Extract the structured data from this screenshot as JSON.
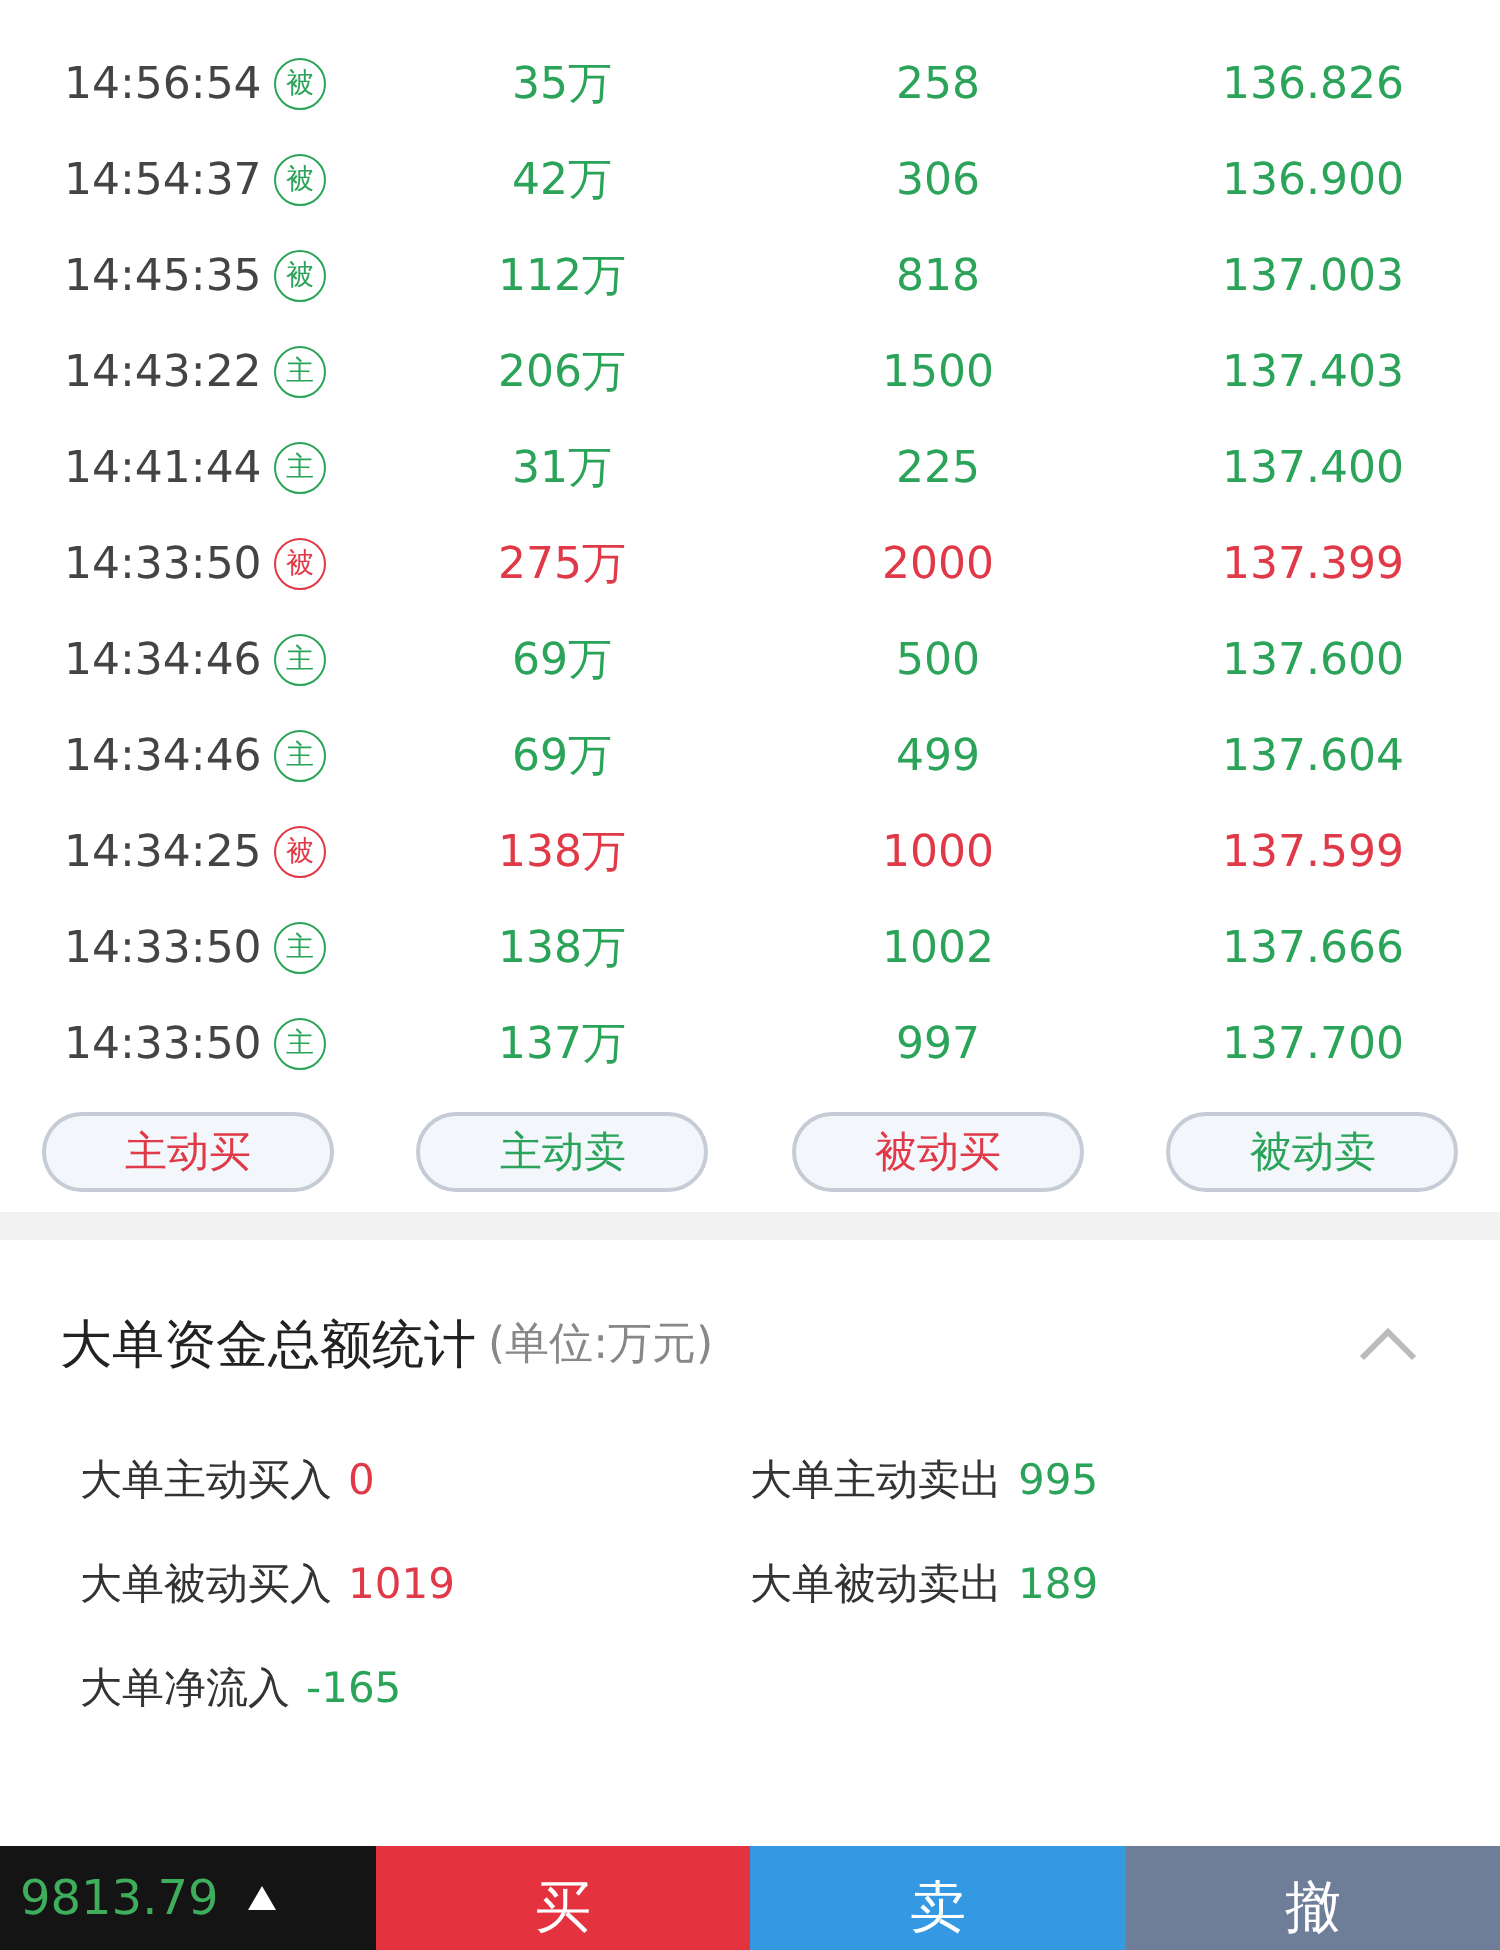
{
  "trades": [
    {
      "time": "14:56:54",
      "tag": "被",
      "amount": "35万",
      "volume": "258",
      "price": "136.826",
      "color": "#2ba45a"
    },
    {
      "time": "14:54:37",
      "tag": "被",
      "amount": "42万",
      "volume": "306",
      "price": "136.900",
      "color": "#2ba45a"
    },
    {
      "time": "14:45:35",
      "tag": "被",
      "amount": "112万",
      "volume": "818",
      "price": "137.003",
      "color": "#2ba45a"
    },
    {
      "time": "14:43:22",
      "tag": "主",
      "amount": "206万",
      "volume": "1500",
      "price": "137.403",
      "color": "#2ba45a"
    },
    {
      "time": "14:41:44",
      "tag": "主",
      "amount": "31万",
      "volume": "225",
      "price": "137.400",
      "color": "#2ba45a"
    },
    {
      "time": "14:33:50",
      "tag": "被",
      "amount": "275万",
      "volume": "2000",
      "price": "137.399",
      "color": "#e03a48"
    },
    {
      "time": "14:34:46",
      "tag": "主",
      "amount": "69万",
      "volume": "500",
      "price": "137.600",
      "color": "#2ba45a"
    },
    {
      "time": "14:34:46",
      "tag": "主",
      "amount": "69万",
      "volume": "499",
      "price": "137.604",
      "color": "#2ba45a"
    },
    {
      "time": "14:34:25",
      "tag": "被",
      "amount": "138万",
      "volume": "1000",
      "price": "137.599",
      "color": "#e03a48"
    },
    {
      "time": "14:33:50",
      "tag": "主",
      "amount": "138万",
      "volume": "1002",
      "price": "137.666",
      "color": "#2ba45a"
    },
    {
      "time": "14:33:50",
      "tag": "主",
      "amount": "137万",
      "volume": "997",
      "price": "137.700",
      "color": "#2ba45a"
    }
  ],
  "filters": [
    {
      "label": "主动买",
      "color": "#e03a48"
    },
    {
      "label": "主动卖",
      "color": "#2ba45a"
    },
    {
      "label": "被动买",
      "color": "#e03a48"
    },
    {
      "label": "被动卖",
      "color": "#2ba45a"
    }
  ],
  "summary": {
    "title": "大单资金总额统计",
    "unit": "(单位:万元)",
    "expanded": true,
    "stats": [
      {
        "label": "大单主动买入",
        "value": "0",
        "color": "#e03a48"
      },
      {
        "label": "大单主动卖出",
        "value": "995",
        "color": "#2ba45a"
      },
      {
        "label": "大单被动买入",
        "value": "1019",
        "color": "#e03a48"
      },
      {
        "label": "大单被动卖出",
        "value": "189",
        "color": "#2ba45a"
      },
      {
        "label": "大单净流入",
        "value": "-165",
        "color": "#2ba45a"
      }
    ]
  },
  "bottom_bar": {
    "price": "9813.79",
    "actions": [
      {
        "label": "买",
        "kind": "buy"
      },
      {
        "label": "卖",
        "kind": "sell"
      },
      {
        "label": "撤",
        "kind": "cancel"
      }
    ]
  }
}
